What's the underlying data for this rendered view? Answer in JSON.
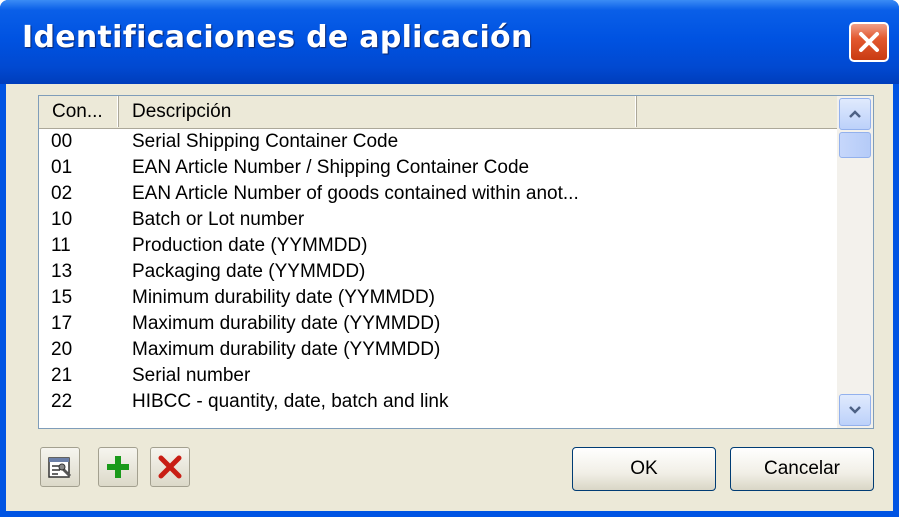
{
  "window": {
    "title": "Identificaciones de aplicación",
    "close_icon": "close-icon"
  },
  "list": {
    "columns": [
      "Con...",
      "Descripción",
      ""
    ],
    "rows": [
      {
        "code": "00",
        "description": "Serial Shipping Container Code"
      },
      {
        "code": "01",
        "description": "EAN Article Number / Shipping Container Code"
      },
      {
        "code": "02",
        "description": "EAN Article Number of goods contained within anot..."
      },
      {
        "code": "10",
        "description": "Batch or Lot number"
      },
      {
        "code": "11",
        "description": "Production date (YYMMDD)"
      },
      {
        "code": "13",
        "description": "Packaging date (YYMMDD)"
      },
      {
        "code": "15",
        "description": "Minimum durability date (YYMMDD)"
      },
      {
        "code": "17",
        "description": "Maximum durability date (YYMMDD)"
      },
      {
        "code": "20",
        "description": "Maximum durability date (YYMMDD)"
      },
      {
        "code": "21",
        "description": "Serial number"
      },
      {
        "code": "22",
        "description": "HIBCC - quantity, date, batch and link"
      }
    ]
  },
  "toolbar": {
    "properties_icon": "properties-icon",
    "add_icon": "add-icon",
    "delete_icon": "delete-icon"
  },
  "buttons": {
    "ok_label": "OK",
    "cancel_label": "Cancelar"
  },
  "colors": {
    "titlebar": "#0054e3",
    "close": "#e3592f",
    "dialog_bg": "#ece9d8",
    "add_green": "#1a9a1a",
    "delete_red": "#c81e14"
  }
}
